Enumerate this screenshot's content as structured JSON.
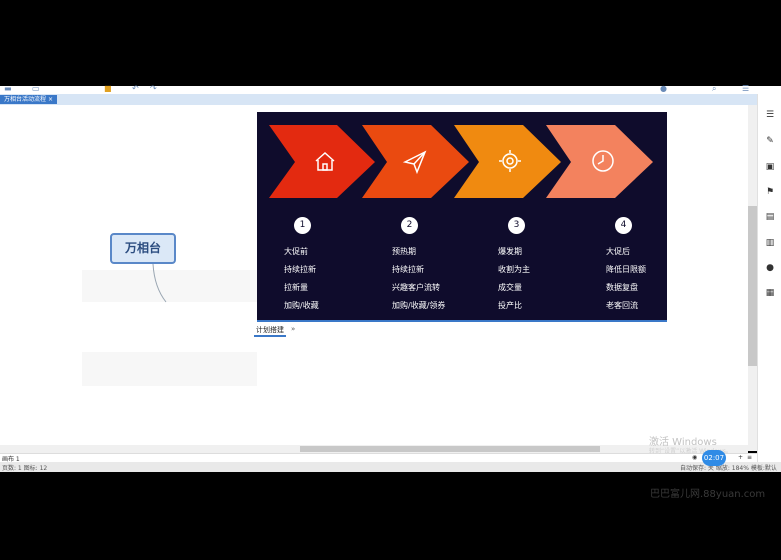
{
  "window": {
    "doc_tab": "万相台活动流程",
    "doc_tab_close": "×"
  },
  "mindmap": {
    "root": "万相台"
  },
  "banner": {
    "stages": [
      {
        "number": "1",
        "icon": "home-icon",
        "color": "#e32a10",
        "items": [
          "大促前",
          "持续拉新",
          "拉新量",
          "加购/收藏"
        ]
      },
      {
        "number": "2",
        "icon": "paper-plane-icon",
        "color": "#ea4a10",
        "items": [
          "预热期",
          "持续拉新",
          "兴趣客户流转",
          "加购/收藏/领券"
        ]
      },
      {
        "number": "3",
        "icon": "gear-icon",
        "color": "#f08a10",
        "items": [
          "爆发期",
          "收割为主",
          "成交量",
          "投产比"
        ]
      },
      {
        "number": "4",
        "icon": "clock-icon",
        "color": "#f3825e",
        "items": [
          "大促后",
          "降低日限额",
          "数据复盘",
          "老客回流"
        ]
      }
    ]
  },
  "sheet": {
    "tab_label": "计划搭建",
    "tab_arrow": "»"
  },
  "status": {
    "left_text": "画布 1",
    "bottom_left": "页数: 1 图标: 12",
    "bottom_right": "自动保存: 关   缩放: 184% 模板:默认"
  },
  "watermark": {
    "line1": "激活 Windows",
    "line2": "转到“设置”以激活 Windows。"
  },
  "timer": "02:07",
  "site": "巴巴富儿网.88yuan.com"
}
